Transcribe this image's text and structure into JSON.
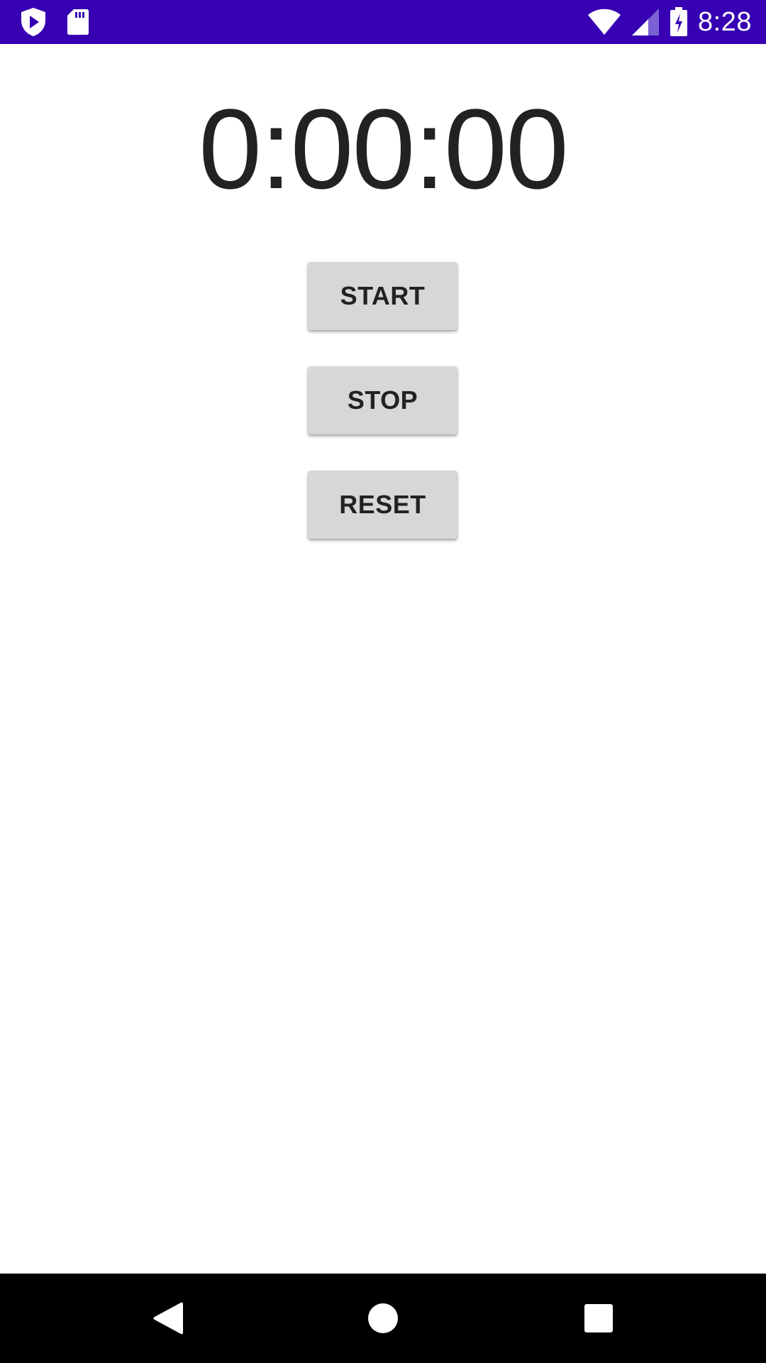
{
  "status_bar": {
    "time": "8:28",
    "background": "#3700b3",
    "left_icons": [
      "shield-play-icon",
      "sd-card-icon"
    ],
    "right_icons": [
      "wifi-icon",
      "cell-signal-icon",
      "battery-charging-icon"
    ]
  },
  "stopwatch": {
    "time_display": "0:00:00",
    "buttons": {
      "start_label": "START",
      "stop_label": "STOP",
      "reset_label": "RESET"
    },
    "button_color": "#d6d7d7",
    "text_color": "#222222"
  },
  "nav_bar": {
    "background": "#000000",
    "icons": [
      "back-icon",
      "home-icon",
      "recents-icon"
    ]
  }
}
